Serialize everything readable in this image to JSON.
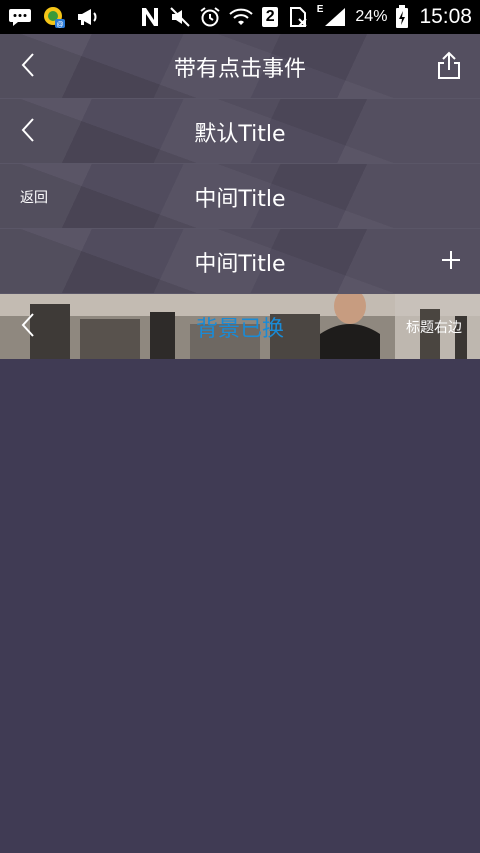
{
  "status_bar": {
    "battery_percent": "24%",
    "sim_slot": "2",
    "network_type": "E",
    "time": "15:08",
    "icons": [
      "chat-icon",
      "app-badge-icon",
      "megaphone-icon",
      "nfc-icon",
      "mute-icon",
      "alarm-icon",
      "wifi-icon",
      "sim-icon",
      "no-sim-icon",
      "signal-icon",
      "battery-charging-icon"
    ]
  },
  "bars": {
    "bar1": {
      "title": "带有点击事件",
      "left_icon": "back-arrow-icon",
      "right_icon": "share-icon"
    },
    "bar2": {
      "title": "默认Title",
      "left_icon": "back-arrow-icon"
    },
    "bar3": {
      "title": "中间Title",
      "left_text": "返回"
    },
    "bar4": {
      "title": "中间Title",
      "right_icon": "plus-icon"
    },
    "bar5": {
      "title": "背景已换",
      "left_icon": "back-arrow-icon",
      "right_text": "标题右边",
      "title_color": "#1a8bd6"
    }
  },
  "colors": {
    "page_background": "#403b54",
    "bar_background": "#514c5e",
    "status_background": "#000000"
  }
}
